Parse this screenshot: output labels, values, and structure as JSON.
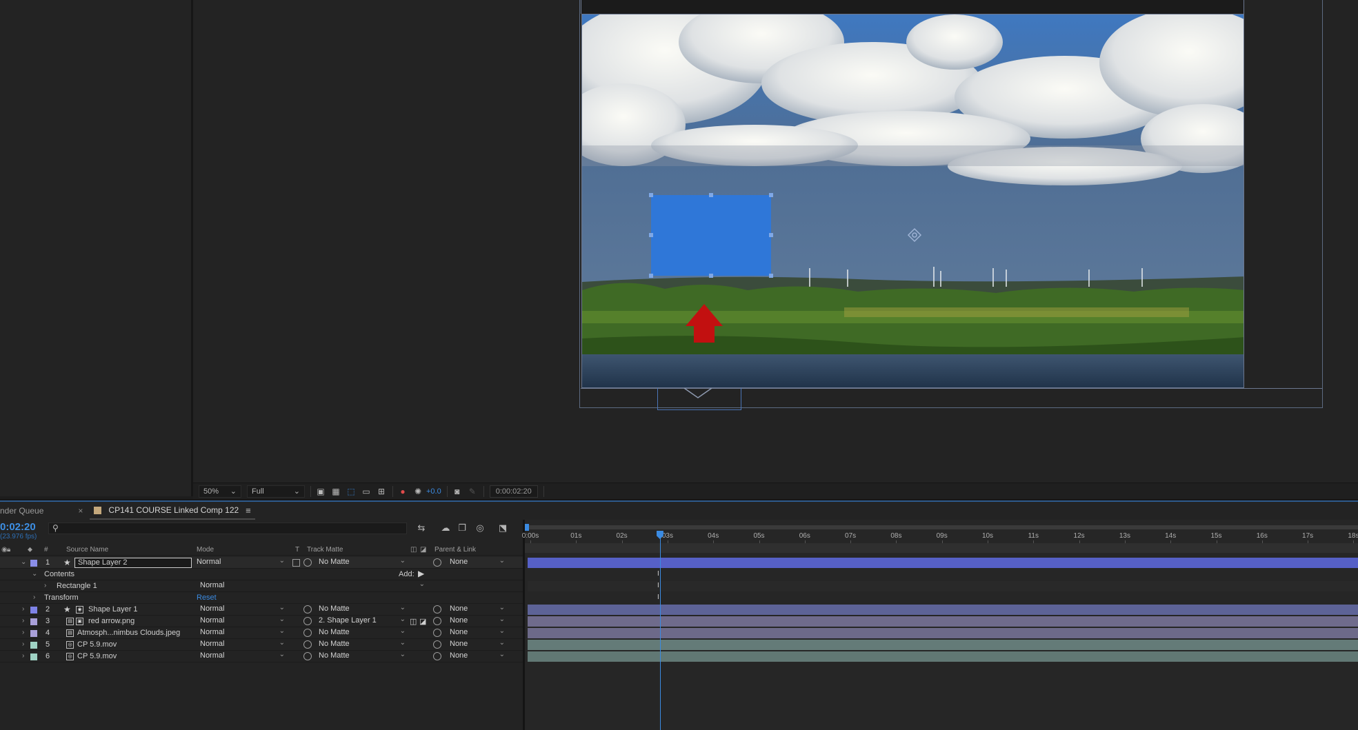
{
  "viewer": {
    "zoom": "50%",
    "resolution": "Full",
    "exposure": "+0.0",
    "timecode": "0:00:02:20",
    "icons": [
      "region-of-interest-icon",
      "transparency-grid-icon",
      "mask-visibility-icon",
      "grid-guides-icon",
      "3d-view-icon",
      "color-channel-icon",
      "color-management-icon",
      "snapshot-camera-icon",
      "show-snapshot-icon"
    ]
  },
  "tabs": {
    "render_queue": "nder Queue",
    "comp_name": "CP141 COURSE Linked Comp 122",
    "close": "×",
    "menu": "≡"
  },
  "timeline": {
    "current_time": "0:02:20",
    "fps": "(23.976 fps)",
    "search_placeholder": ""
  },
  "columns": {
    "hash": "#",
    "source_name": "Source Name",
    "mode": "Mode",
    "t": "T",
    "track_matte": "Track Matte",
    "parent_link": "Parent & Link"
  },
  "layers": [
    {
      "num": "1",
      "name": "Shape Layer 2",
      "mode": "Normal",
      "matte": "No Matte",
      "parent": "None",
      "color": "#8a8ee8"
    },
    {
      "num": "2",
      "name": "Shape Layer 1",
      "mode": "Normal",
      "matte": "No Matte",
      "parent": "None",
      "color": "#7e82e6"
    },
    {
      "num": "3",
      "name": "red arrow.png",
      "mode": "Normal",
      "matte": "2. Shape Layer 1",
      "parent": "None",
      "color": "#a9a0d9"
    },
    {
      "num": "4",
      "name": "Atmosph...nimbus Clouds.jpeg",
      "mode": "Normal",
      "matte": "No Matte",
      "parent": "None",
      "color": "#a9a0d9"
    },
    {
      "num": "5",
      "name": "CP 5.9.mov",
      "mode": "Normal",
      "matte": "No Matte",
      "parent": "None",
      "color": "#9fd2c4"
    },
    {
      "num": "6",
      "name": "CP 5.9.mov",
      "mode": "Normal",
      "matte": "No Matte",
      "parent": "None",
      "color": "#9fd2c4"
    }
  ],
  "sub": {
    "contents": "Contents",
    "add": "Add:",
    "rectangle": "Rectangle 1",
    "rect_mode": "Normal",
    "transform": "Transform",
    "reset": "Reset"
  },
  "ruler": [
    "0:00s",
    "01s",
    "02s",
    "03s",
    "04s",
    "05s",
    "06s",
    "07s",
    "08s",
    "09s",
    "10s",
    "11s",
    "12s",
    "13s",
    "14s",
    "15s",
    "16s",
    "17s",
    "18s"
  ],
  "colors": {
    "accent": "#3b8be2",
    "shape_bar": "#5b63c9",
    "shape1_bar": "#666a9e",
    "image_bar": "#73708f",
    "video_bar": "#6a8581"
  }
}
